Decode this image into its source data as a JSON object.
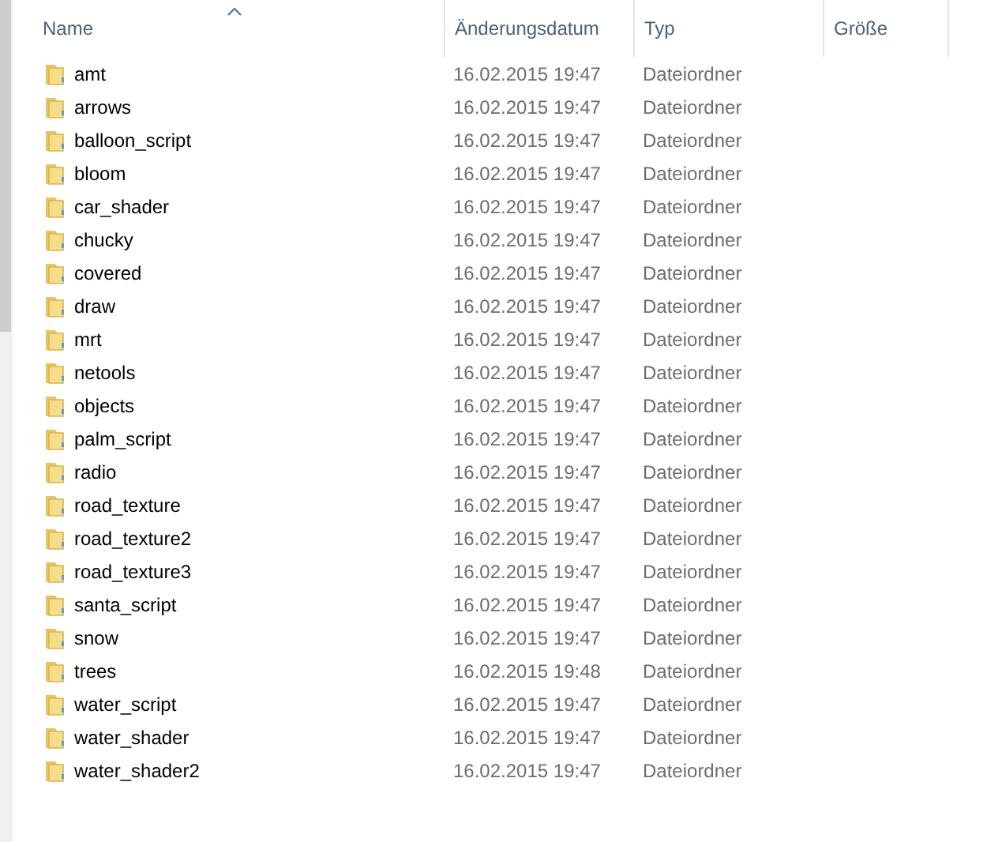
{
  "columns": [
    {
      "label": "Name",
      "sorted": true
    },
    {
      "label": "Änderungsdatum",
      "sorted": false
    },
    {
      "label": "Typ",
      "sorted": false
    },
    {
      "label": "Größe",
      "sorted": false
    }
  ],
  "rows": [
    {
      "name": "amt",
      "modified": "16.02.2015 19:47",
      "type": "Dateiordner"
    },
    {
      "name": "arrows",
      "modified": "16.02.2015 19:47",
      "type": "Dateiordner"
    },
    {
      "name": "balloon_script",
      "modified": "16.02.2015 19:47",
      "type": "Dateiordner"
    },
    {
      "name": "bloom",
      "modified": "16.02.2015 19:47",
      "type": "Dateiordner"
    },
    {
      "name": "car_shader",
      "modified": "16.02.2015 19:47",
      "type": "Dateiordner"
    },
    {
      "name": "chucky",
      "modified": "16.02.2015 19:47",
      "type": "Dateiordner"
    },
    {
      "name": "covered",
      "modified": "16.02.2015 19:47",
      "type": "Dateiordner"
    },
    {
      "name": "draw",
      "modified": "16.02.2015 19:47",
      "type": "Dateiordner"
    },
    {
      "name": "mrt",
      "modified": "16.02.2015 19:47",
      "type": "Dateiordner"
    },
    {
      "name": "netools",
      "modified": "16.02.2015 19:47",
      "type": "Dateiordner"
    },
    {
      "name": "objects",
      "modified": "16.02.2015 19:47",
      "type": "Dateiordner"
    },
    {
      "name": "palm_script",
      "modified": "16.02.2015 19:47",
      "type": "Dateiordner"
    },
    {
      "name": "radio",
      "modified": "16.02.2015 19:47",
      "type": "Dateiordner"
    },
    {
      "name": "road_texture",
      "modified": "16.02.2015 19:47",
      "type": "Dateiordner"
    },
    {
      "name": "road_texture2",
      "modified": "16.02.2015 19:47",
      "type": "Dateiordner"
    },
    {
      "name": "road_texture3",
      "modified": "16.02.2015 19:47",
      "type": "Dateiordner"
    },
    {
      "name": "santa_script",
      "modified": "16.02.2015 19:47",
      "type": "Dateiordner"
    },
    {
      "name": "snow",
      "modified": "16.02.2015 19:47",
      "type": "Dateiordner"
    },
    {
      "name": "trees",
      "modified": "16.02.2015 19:48",
      "type": "Dateiordner"
    },
    {
      "name": "water_script",
      "modified": "16.02.2015 19:47",
      "type": "Dateiordner"
    },
    {
      "name": "water_shader",
      "modified": "16.02.2015 19:47",
      "type": "Dateiordner"
    },
    {
      "name": "water_shader2",
      "modified": "16.02.2015 19:47",
      "type": "Dateiordner"
    }
  ]
}
